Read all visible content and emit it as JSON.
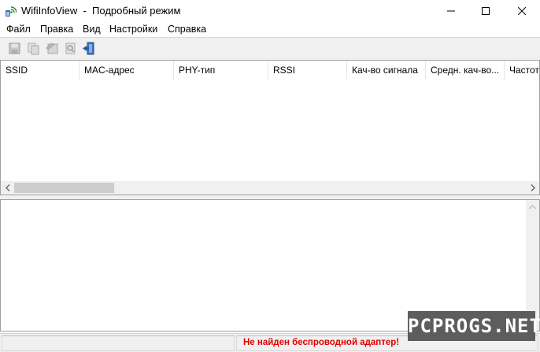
{
  "window": {
    "title": "WifiInfoView  -  Подробный режим",
    "minimize_icon": "minimize-icon",
    "maximize_icon": "maximize-icon",
    "close_icon": "close-icon"
  },
  "menu": {
    "items": [
      {
        "label": "Файл"
      },
      {
        "label": "Правка"
      },
      {
        "label": "Вид"
      },
      {
        "label": "Настройки"
      },
      {
        "label": "Справка"
      }
    ]
  },
  "toolbar": {
    "buttons": [
      {
        "icon": "save-icon",
        "enabled": false
      },
      {
        "icon": "copy-icon",
        "enabled": false
      },
      {
        "icon": "html-report-icon",
        "enabled": false
      },
      {
        "icon": "properties-icon",
        "enabled": false
      },
      {
        "icon": "exit-icon",
        "enabled": true
      }
    ]
  },
  "list": {
    "columns": [
      {
        "label": "SSID"
      },
      {
        "label": "MAC-адрес"
      },
      {
        "label": "PHY-тип"
      },
      {
        "label": "RSSI"
      },
      {
        "label": "Кач-во сигнала"
      },
      {
        "label": "Средн. кач-во..."
      },
      {
        "label": "Частот"
      }
    ],
    "rows": []
  },
  "status": {
    "message": "Не найден беспроводной адаптер!",
    "message_color": "#e00000"
  },
  "watermark": {
    "text": "PCPROGS.NET"
  },
  "colors": {
    "chrome_bg": "#f0f0f0",
    "scroll_thumb": "#cdcdcd"
  }
}
